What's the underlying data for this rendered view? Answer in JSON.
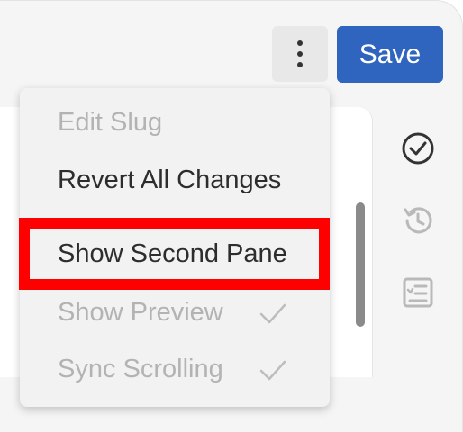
{
  "toolbar": {
    "more_icon": "more-vertical-icon",
    "save_label": "Save"
  },
  "menu": {
    "items": [
      {
        "label": "Edit Slug",
        "enabled": false,
        "checked": false
      },
      {
        "label": "Revert All Changes",
        "enabled": true,
        "checked": false
      },
      {
        "label": "Show Second Pane",
        "enabled": true,
        "checked": false,
        "highlighted": true
      },
      {
        "label": "Show Preview",
        "enabled": false,
        "checked": true
      },
      {
        "label": "Sync Scrolling",
        "enabled": false,
        "checked": true
      }
    ]
  },
  "side_icons": [
    "check-circle-icon",
    "history-icon",
    "checklist-icon"
  ],
  "colors": {
    "primary": "#2f64bf",
    "highlight": "#ff0000",
    "disabled_text": "#b3b3b3"
  }
}
